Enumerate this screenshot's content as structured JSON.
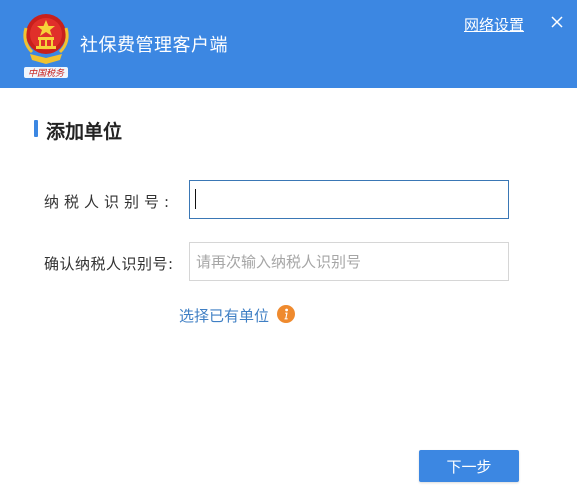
{
  "header": {
    "app_title": "社保费管理客户端",
    "network_settings": "网络设置",
    "logo_caption": "中国税务",
    "close_icon": "close-icon",
    "logo_icon": "tax-emblem-icon"
  },
  "section": {
    "title": "添加单位"
  },
  "form": {
    "taxid_label": "纳税人识别号:",
    "taxid_value": "",
    "taxid_placeholder": "",
    "confirm_label": "确认纳税人识别号:",
    "confirm_value": "",
    "confirm_placeholder": "请再次输入纳税人识别号"
  },
  "actions": {
    "select_existing": "选择已有单位",
    "info_icon": "info-icon",
    "next_button": "下一步"
  },
  "colors": {
    "header_bg": "#3c87e2",
    "accent": "#3c87e2",
    "link": "#3f7fc4",
    "info_icon": "#ef8a2e"
  }
}
